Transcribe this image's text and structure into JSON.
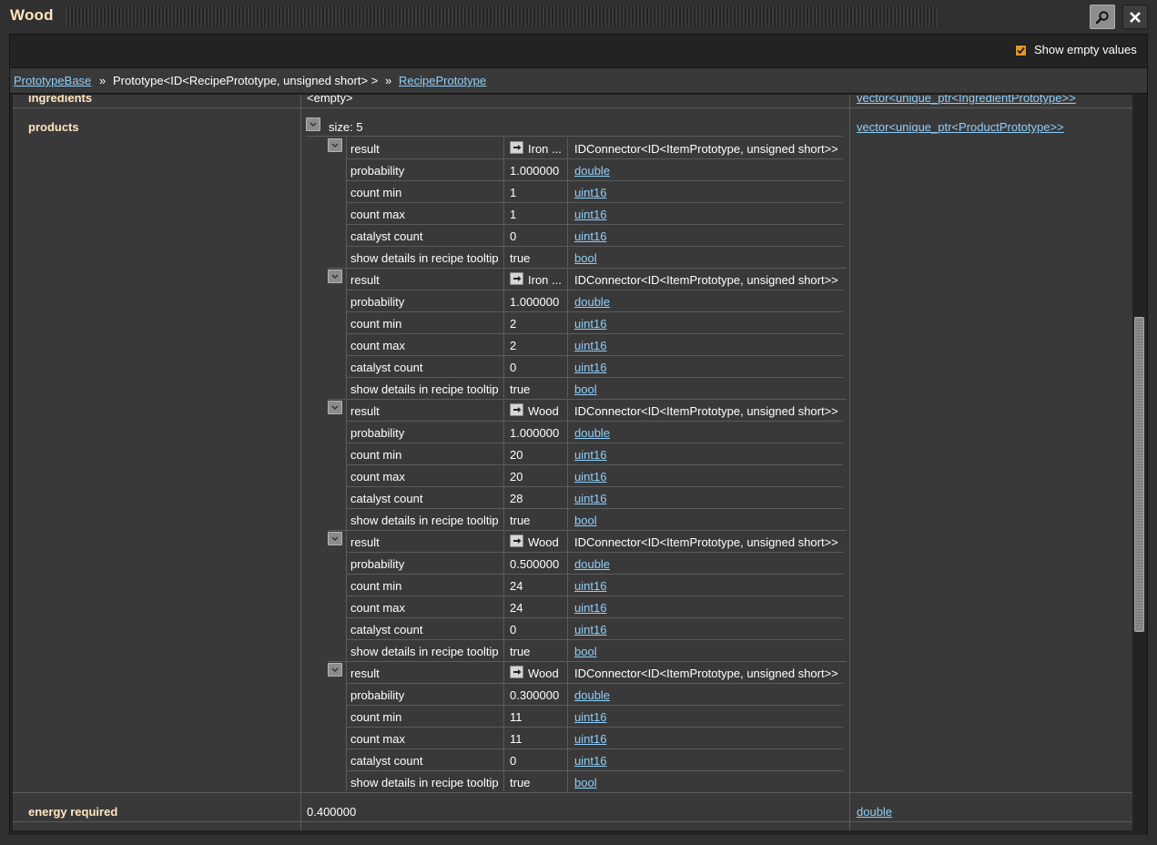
{
  "window": {
    "title": "Wood"
  },
  "toolbar": {
    "show_empty_label": "Show empty values",
    "show_empty_checked": true
  },
  "breadcrumb": {
    "item1": "PrototypeBase",
    "sep": "»",
    "item2": "Prototype<ID<RecipePrototype, unsigned short> >",
    "item3": "RecipePrototype"
  },
  "ingredients": {
    "key": "ingredients",
    "value": "<empty>",
    "type": "vector<unique_ptr<IngredientPrototype>>"
  },
  "products": {
    "key": "products",
    "size_label": "size: 5",
    "type": "vector<unique_ptr<ProductPrototype>>",
    "items": [
      {
        "result": "Iron ...",
        "probability": "1.000000",
        "count_min": "1",
        "count_max": "1",
        "catalyst_count": "0",
        "show_details": "true"
      },
      {
        "result": "Iron ...",
        "probability": "1.000000",
        "count_min": "2",
        "count_max": "2",
        "catalyst_count": "0",
        "show_details": "true"
      },
      {
        "result": "Wood",
        "probability": "1.000000",
        "count_min": "20",
        "count_max": "20",
        "catalyst_count": "28",
        "show_details": "true"
      },
      {
        "result": "Wood",
        "probability": "0.500000",
        "count_min": "24",
        "count_max": "24",
        "catalyst_count": "0",
        "show_details": "true"
      },
      {
        "result": "Wood",
        "probability": "0.300000",
        "count_min": "11",
        "count_max": "11",
        "catalyst_count": "0",
        "show_details": "true"
      }
    ]
  },
  "fields": {
    "result": "result",
    "probability": "probability",
    "count_min": "count min",
    "count_max": "count max",
    "catalyst_count": "catalyst count",
    "show_details": "show details in recipe tooltip"
  },
  "types": {
    "result": "IDConnector<ID<ItemPrototype, unsigned short>>",
    "double": "double",
    "uint16": "uint16",
    "bool": "bool"
  },
  "energy": {
    "key": "energy required",
    "value": "0.400000",
    "type": "double"
  }
}
